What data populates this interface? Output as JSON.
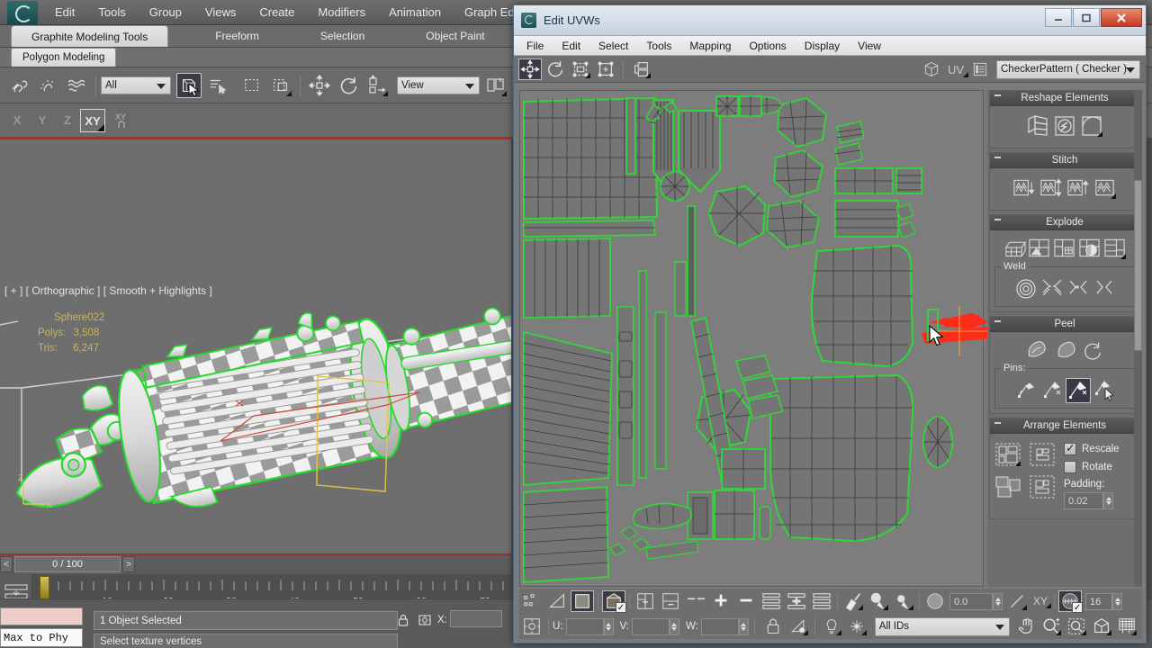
{
  "app": {
    "menu": [
      "Edit",
      "Tools",
      "Group",
      "Views",
      "Create",
      "Modifiers",
      "Animation",
      "Graph Editors"
    ],
    "ribbon_tabs": [
      {
        "label": "Graphite Modeling Tools",
        "active": true
      },
      {
        "label": "Freeform",
        "active": false
      },
      {
        "label": "Selection",
        "active": false
      },
      {
        "label": "Object Paint",
        "active": false
      }
    ],
    "ribbon_subtab": "Polygon Modeling",
    "toolbar": {
      "selection_filter_value": "All",
      "coord_system_value": "View",
      "axis_buttons": [
        "X",
        "Y",
        "Z",
        "XY"
      ],
      "axis_selected": "XY"
    }
  },
  "viewport": {
    "label": "[ + ] [ Orthographic ] [ Smooth + Highlights ]",
    "object_name": "Sphere022",
    "polys_label": "Polys:",
    "polys_value": "3,508",
    "tris_label": "Tris:",
    "tris_value": "6,247",
    "axis_gizmo": {
      "z": "Z",
      "y": "Y",
      "x": "X"
    }
  },
  "timeline": {
    "prev": "<",
    "next": ">",
    "frame_readout": "0 / 100",
    "ticks": [
      "10",
      "20",
      "30",
      "40",
      "50",
      "60",
      "70"
    ]
  },
  "statusbar": {
    "max_to_phys": "Max to Phy",
    "selection_status": "1 Object Selected",
    "prompt": "Select texture vertices",
    "coord_x_label": "X:"
  },
  "uvw": {
    "title": "Edit UVWs",
    "window_buttons": {
      "minimize": "minimize-icon",
      "maximize": "maximize-icon",
      "close": "X"
    },
    "menu": [
      "File",
      "Edit",
      "Select",
      "Tools",
      "Mapping",
      "Options",
      "Display",
      "View"
    ],
    "toolbar": {
      "move_tool": "move-icon",
      "rotate_tool": "rotate-icon",
      "scale_tool": "scale-icon",
      "freeform_tool": "freeform-icon",
      "mirror_tool": "mirror-icon",
      "uv_label": "UV",
      "texture_dropdown": "CheckerPattern  ( Checker )"
    },
    "rollouts": [
      {
        "title": "Reshape Elements",
        "buttons": [
          "reshape-element-icon",
          "relax-icon",
          "peel-mode-icon"
        ]
      },
      {
        "title": "Stitch",
        "buttons": [
          "stitch-down-icon",
          "stitch-both-icon",
          "stitch-up-icon",
          "stitch-custom-icon"
        ]
      },
      {
        "title": "Explode",
        "buttons": [
          "explode-icon",
          "break-icon",
          "detach-icon",
          "explode-face-icon",
          "explode-custom-icon"
        ],
        "group": {
          "label": "Weld",
          "buttons": [
            "target-weld-icon",
            "weld-selected-icon",
            "weld-shared-icon",
            "weld-split-icon"
          ]
        }
      },
      {
        "title": "Peel",
        "buttons": [
          "quick-peel-icon",
          "peel-mode-icon",
          "reset-peel-icon"
        ],
        "group": {
          "label": "Pins:",
          "buttons": [
            "pin-icon",
            "unpin-icon",
            "pin-selected-icon",
            "pin-paint-icon"
          ],
          "selected_index": 2
        }
      },
      {
        "title": "Arrange Elements",
        "buttons": [
          "pack-normalize-icon",
          "pack-custom-icon",
          "pack-uv-icon",
          "pack-tight-icon",
          "pack-rescale-icon"
        ],
        "options": {
          "rescale_label": "Rescale",
          "rescale_checked": true,
          "rotate_label": "Rotate",
          "rotate_checked": false,
          "padding_label": "Padding:",
          "padding_value": "0.02"
        }
      }
    ],
    "bottombar": {
      "u_label": "U:",
      "u_value": "",
      "v_label": "V:",
      "v_value": "",
      "w_label": "W:",
      "w_value": "",
      "angle_value": "0.0",
      "xy_label": "XY",
      "grid_value": "16",
      "ids_dropdown": "All IDs",
      "nav_icons": [
        "pan-icon",
        "zoom-icon",
        "zoom-region-icon",
        "zoom-extents-icon",
        "zoom-extents-selected-icon"
      ],
      "left_icons": [
        "vertex-sub-icon",
        "edge-sub-icon",
        "face-sub-icon",
        "element-sub-icon",
        "filter-selected-faces-icon",
        "show-map-icon",
        "grid-snap-icon",
        "plus-icon",
        "minus-icon",
        "stack-icon",
        "stack-plus-icon",
        "stack-minus-icon",
        "paint-select-icon",
        "soft-sel-icon",
        "soft-sel-2-icon"
      ],
      "row2_icons": [
        "center-icon",
        "lock-icon",
        "filter-icon",
        "light-icon",
        "snap-icon"
      ]
    }
  },
  "colors": {
    "uv_edge": "#31d737",
    "uv_selected": "#fd2b19",
    "uv_wire": "#3a3a3a",
    "accent_yellow": "#c8b35e",
    "panel_bg": "#6e6e6e",
    "title_blue": "#18334d"
  },
  "chart_data": null
}
